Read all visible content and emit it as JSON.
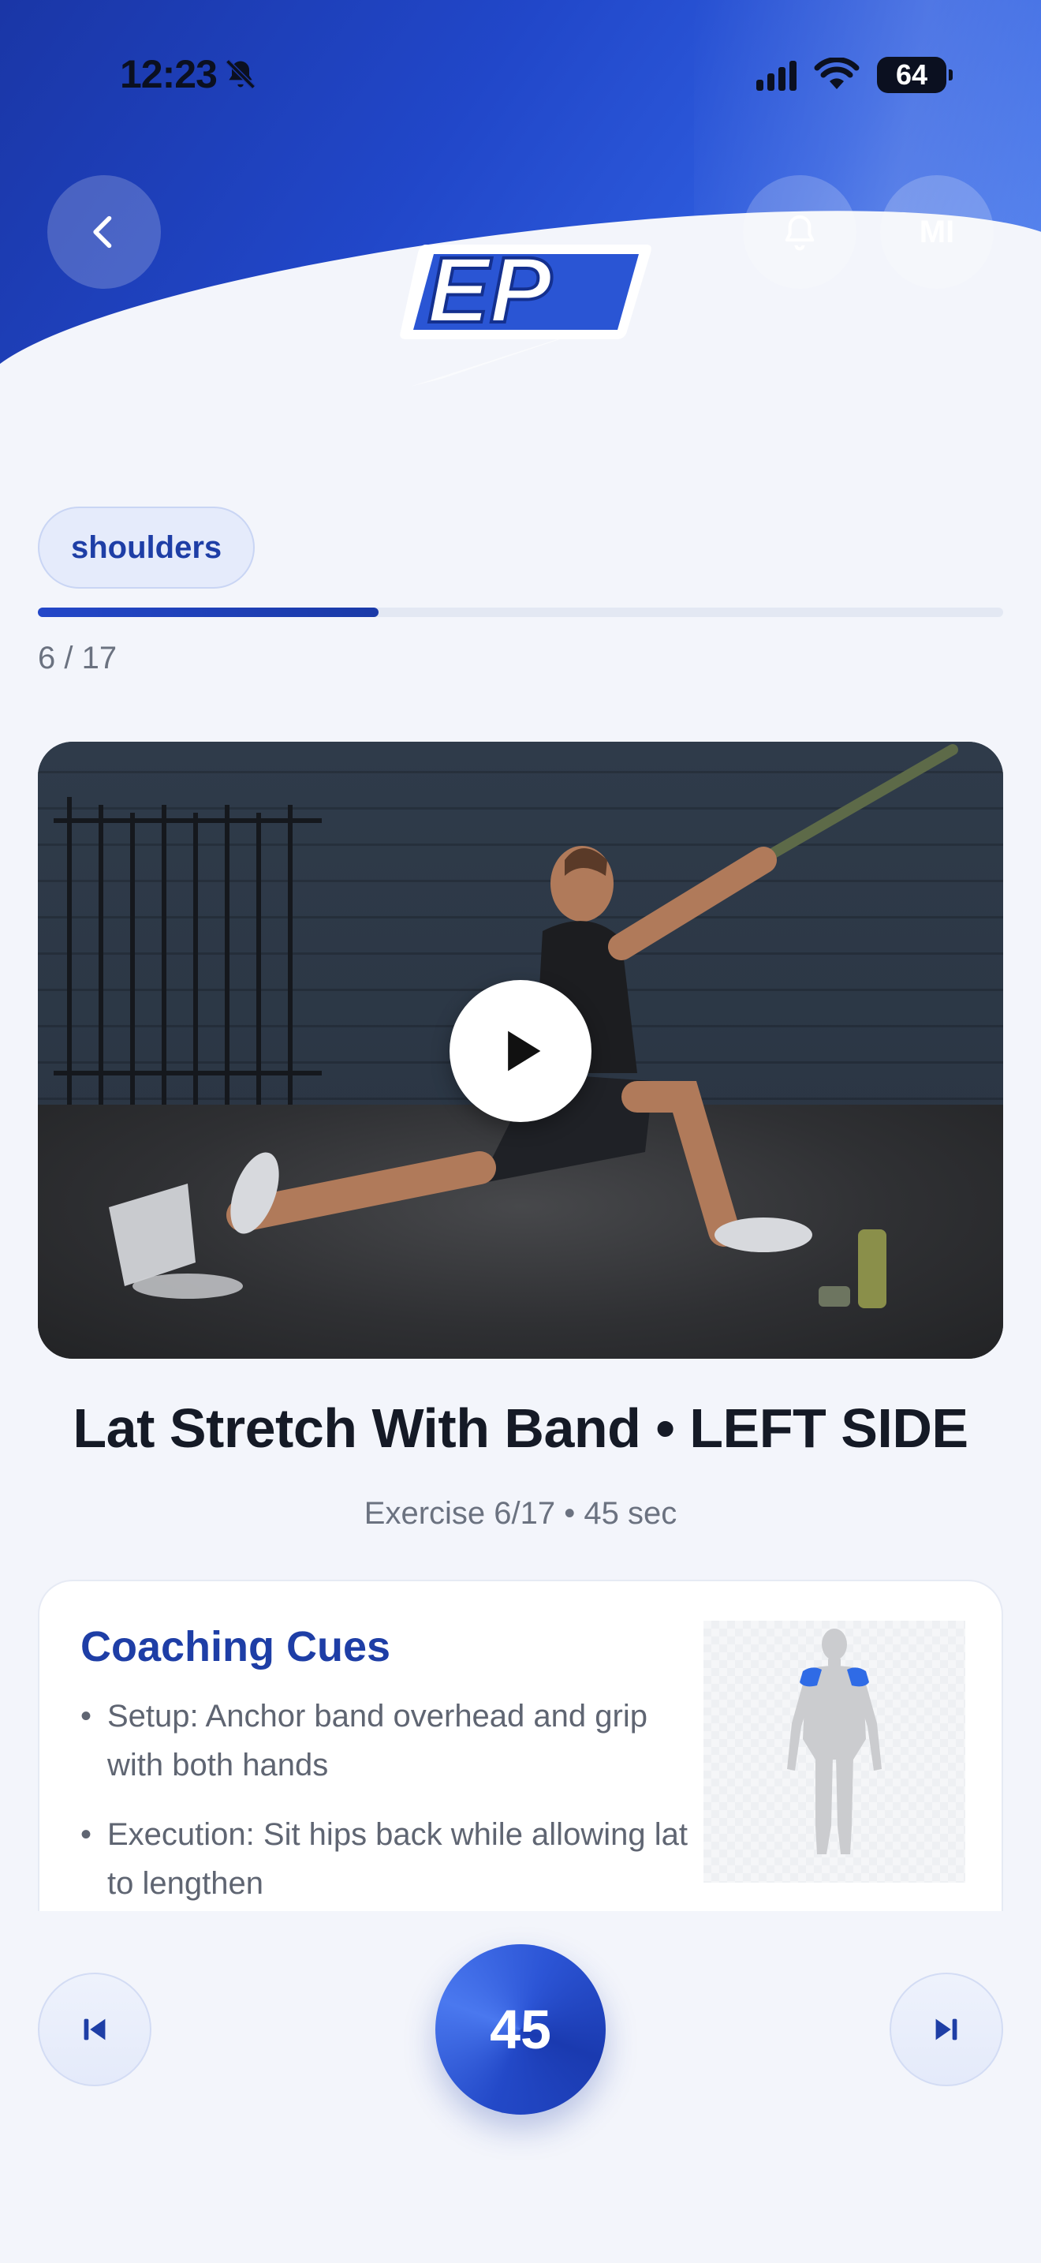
{
  "status_bar": {
    "time": "12:23",
    "battery": "64"
  },
  "header": {
    "avatar_initials": "MI"
  },
  "workout": {
    "tag": "shoulders",
    "progress_text": "6 / 17",
    "progress_fraction": 0.353
  },
  "exercise": {
    "title": "Lat Stretch With Band • LEFT SIDE",
    "meta": "Exercise 6/17 • 45 sec"
  },
  "cues": {
    "title": "Coaching Cues",
    "items": [
      "Setup: Anchor band overhead and grip with both hands",
      "Execution: Sit hips back while allowing lat to lengthen"
    ]
  },
  "controls": {
    "timer": "45"
  },
  "colors": {
    "primary": "#1e3ea6",
    "header_gradient_start": "#1a36a6",
    "header_gradient_end": "#5a8af2",
    "highlight_muscle": "#2f6be6"
  }
}
